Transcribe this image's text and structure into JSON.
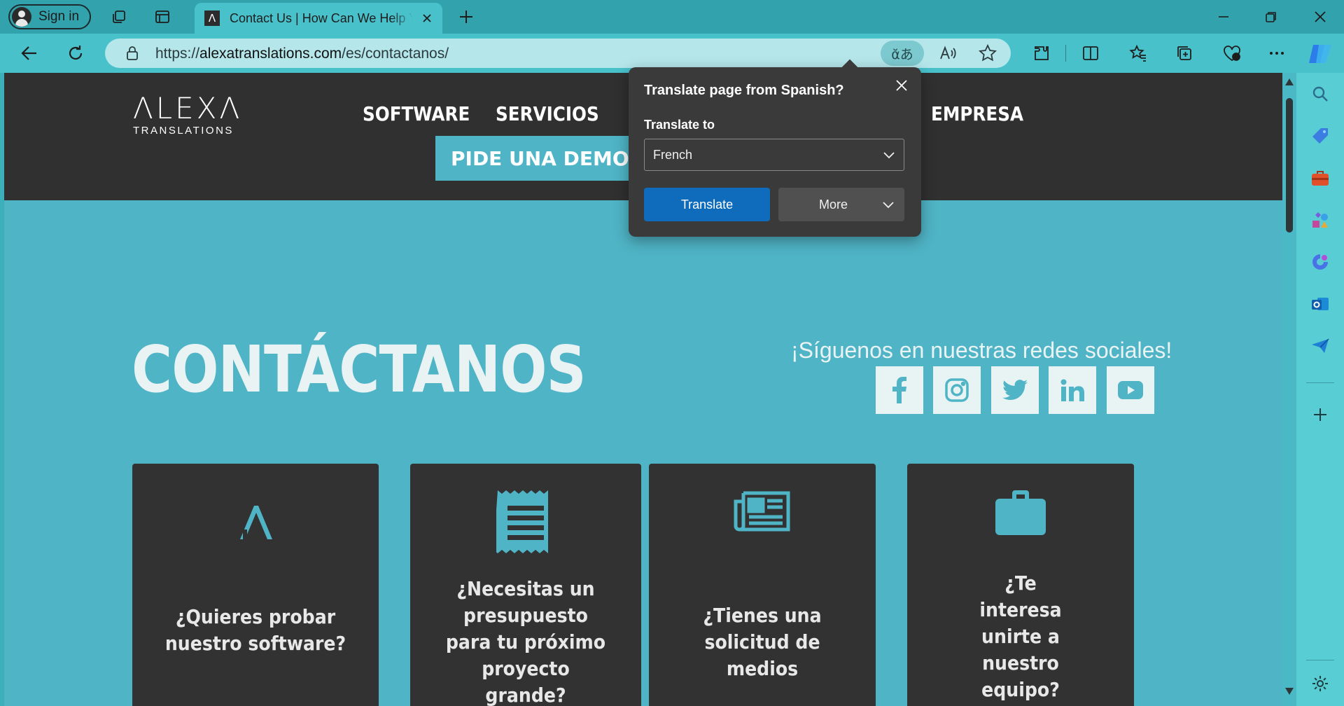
{
  "browser": {
    "signin_label": "Sign in",
    "tab_title": "Contact Us | How Can We Help You",
    "tab_favicon": "Λ",
    "url_prefix": "https://",
    "url_host": "alexatranslations.com",
    "url_path": "/es/contactanos/",
    "translate_glyph": "ᾰあ"
  },
  "site": {
    "logo_mark": "ΛLEXΛ",
    "logo_sub": "TRANSLATIONS",
    "menu": [
      "SOFTWARE",
      "SERVICIOS",
      "EMPRESA"
    ],
    "demo_button": "PIDE UNA DEMOSTRACIÓN",
    "hero_title": "CONTÁCTANOS",
    "social_title": "¡Síguenos en nuestras redes sociales!",
    "social_icons": [
      "facebook-icon",
      "instagram-icon",
      "twitter-icon",
      "linkedin-icon",
      "youtube-icon"
    ],
    "cards": [
      {
        "icon": "alexa-logo-icon",
        "text": "¿Quieres probar nuestro software?"
      },
      {
        "icon": "receipt-icon",
        "text": "¿Necesitas un presupuesto para tu próximo proyecto grande?"
      },
      {
        "icon": "newspaper-icon",
        "text": "¿Tienes una solicitud de medios"
      },
      {
        "icon": "briefcase-icon",
        "text": "¿Te interesa unirte a nuestro equipo?"
      }
    ]
  },
  "translate_popup": {
    "title": "Translate page from Spanish?",
    "translate_to_label": "Translate to",
    "selected_language": "French",
    "translate_button": "Translate",
    "more_button": "More"
  },
  "colors": {
    "accent": "#0f6cbd",
    "site_teal": "#4fb4c6",
    "header_dark": "#303030"
  }
}
